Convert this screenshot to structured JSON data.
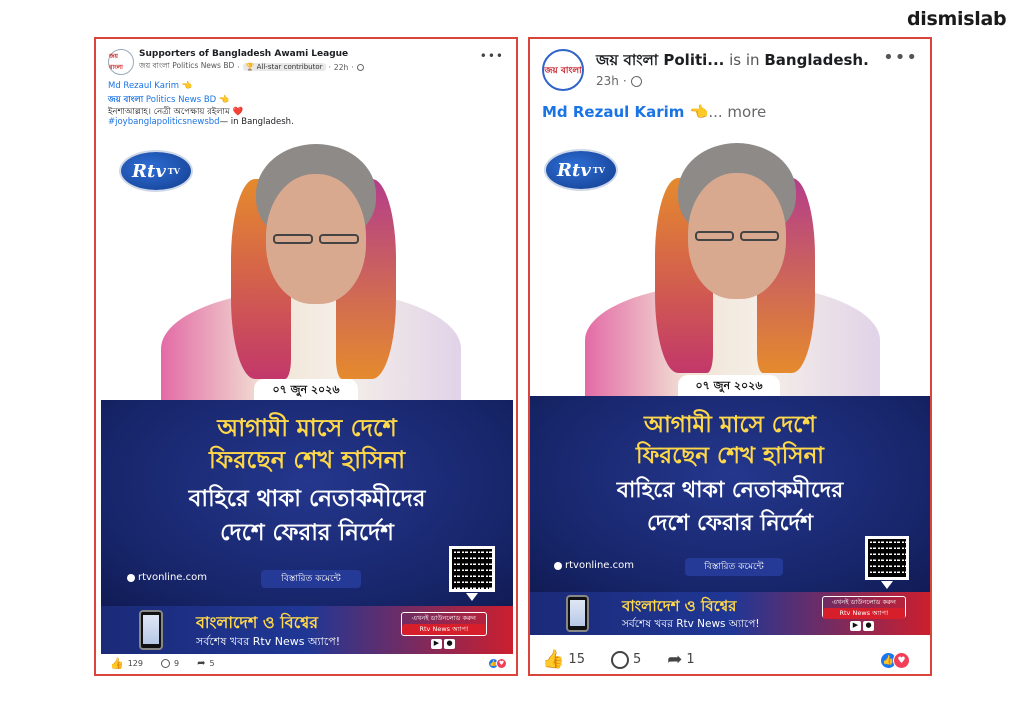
{
  "brand": "dismislab",
  "left_post": {
    "group_name": "Supporters of Bangladesh Awami League",
    "page_name": "জয় বাংলা Politics News BD",
    "badge": "All-star contributor",
    "time": "22h",
    "avatar_text": "জয় বাংলা",
    "author": "Md Rezaul Karim 👈",
    "line2_bn": "জয় বাংলা",
    "line2_rest": " Politics News BD 👈",
    "line3": "ইনশাআল্লাহ। নেত্রী অপেক্ষায় রইলাম ❤️",
    "hashtag": "#joybanglapoliticsnewsbd",
    "location_prefix": "— in ",
    "location": "Bangladesh.",
    "likes": "129",
    "comments": "9",
    "shares": "5"
  },
  "right_post": {
    "page_name": "জয় বাংলা Politi...",
    "is_in": " is in ",
    "location": "Bangladesh.",
    "time": "23h",
    "avatar_text": "জয় বাংলা",
    "author": "Md Rezaul Karim 👈",
    "more": "... more",
    "likes": "15",
    "comments": "5",
    "shares": "1"
  },
  "poster": {
    "logo": "Rtv",
    "date": "০৭ জুন ২০২৬",
    "headline_1": "আগামী মাসে দেশে",
    "headline_2": "ফিরছেন শেখ হাসিনা",
    "headline_3": "বাহিরে থাকা নেতাকমীদের",
    "headline_4": "দেশে ফেরার নির্দেশ",
    "website": "rtvonline.com",
    "comment_tag": "বিস্তারিত কমেন্টে",
    "app_title": "বাংলাদেশ ও বিশ্বের",
    "app_subtitle": "সর্বশেষ খবর Rtv News অ্যাপে!",
    "download_text": "এখনই ডাউনলোড করুন",
    "download_app": "Rtv News অ্যাপ!",
    "store_1": "▶",
    "store_2": ""
  },
  "colors": {
    "card_border": "#d9453a",
    "banner_blue": "#17256a",
    "headline_yellow": "#ffd84a",
    "link_blue": "#1b74e4",
    "like_blue": "#1877f2",
    "love_red": "#f33e58"
  }
}
